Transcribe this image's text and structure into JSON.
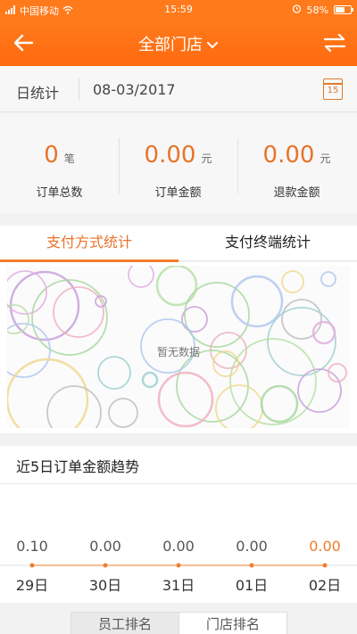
{
  "status_bar": {
    "carrier": "中国移动",
    "time": "15:59",
    "battery": "58%"
  },
  "nav": {
    "title": "全部门店",
    "back_icon": "arrow-left-icon",
    "swap_icon": "swap-arrows-icon"
  },
  "date_row": {
    "label": "日统计",
    "date": "08-03/2017",
    "calendar_day": "15"
  },
  "stats": [
    {
      "value": "0",
      "unit": "笔",
      "caption": "订单总数"
    },
    {
      "value": "0.00",
      "unit": "元",
      "caption": "订单金额"
    },
    {
      "value": "0.00",
      "unit": "元",
      "caption": "退款金额"
    }
  ],
  "tabs": [
    {
      "label": "支付方式统计",
      "active": true
    },
    {
      "label": "支付终端统计",
      "active": false
    }
  ],
  "pay_chart": {
    "empty_text": "暂无数据"
  },
  "trend": {
    "title": "近5日订单金额趋势"
  },
  "chart_data": {
    "type": "line",
    "categories": [
      "29日",
      "30日",
      "31日",
      "01日",
      "02日"
    ],
    "values": [
      0.1,
      0.0,
      0.0,
      0.0,
      0.0
    ],
    "value_labels": [
      "0.10",
      "0.00",
      "0.00",
      "0.00",
      "0.00"
    ],
    "title": "近5日订单金额趋势",
    "highlight_index": 4,
    "color": "#f07d2a"
  },
  "bottom_tabs": [
    {
      "label": "员工排名"
    },
    {
      "label": "门店排名"
    }
  ],
  "colors": {
    "brand": "#ff7a1a",
    "accent": "#e8732a"
  }
}
